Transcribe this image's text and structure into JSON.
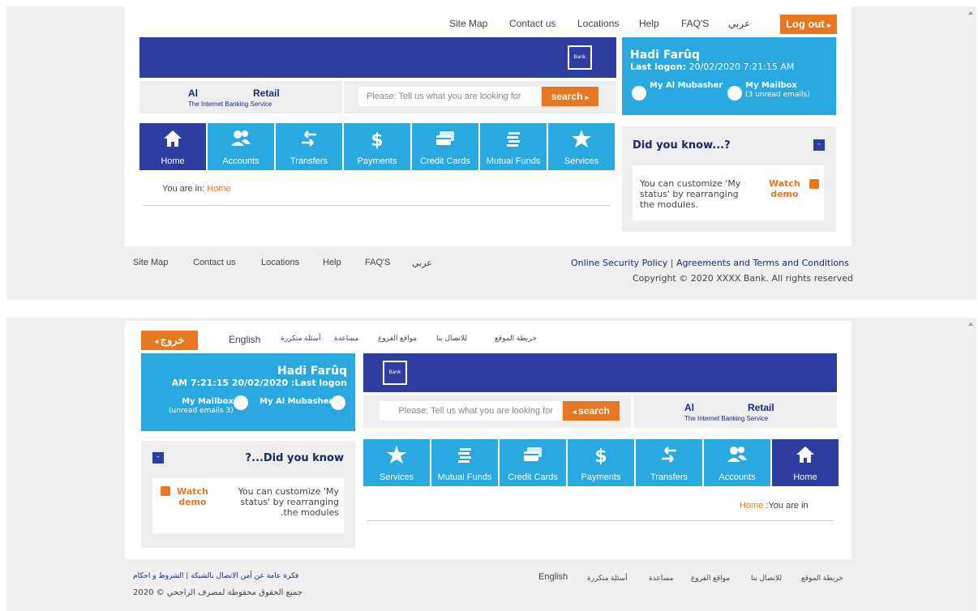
{
  "top_nav_en": [
    "Site Map",
    "Contact us",
    "Locations",
    "Help",
    "FAQ'S",
    "عربي"
  ],
  "top_nav_ar": [
    "خريطة الموقع",
    "للاتصال بنا",
    "مواقع الفروع",
    "مساعدة",
    "أسئلة متكررة",
    "English"
  ],
  "logout_en": "Log out",
  "logout_ar": "خروج",
  "bank_logo_text": "Bank",
  "brand": {
    "al": "Al",
    "retail": "Retail",
    "sub": "The Internet Banking Service"
  },
  "search": {
    "placeholder": "Please: Tell us what you are looking for",
    "button": "search"
  },
  "user": {
    "name": "Hadi Farûq",
    "last_logon_label_en": "Last logon:",
    "last_logon_value_en": "20/02/2020 7:21:15 AM",
    "last_logon_ar": "AM 7:21:15 20/02/2020 :Last logon",
    "mubasher": "My Al Mubasher",
    "mailbox": "My Mailbox",
    "unread_en": "(3 unread emails)",
    "unread_ar": "(unread emails 3)"
  },
  "nav_en": [
    "Home",
    "Accounts",
    "Transfers",
    "Payments",
    "Credit Cards",
    "Mutual Funds",
    "Services"
  ],
  "nav_ar": [
    "Services",
    "Mutual Funds",
    "Credit Cards",
    "Payments",
    "Transfers",
    "Accounts",
    "Home"
  ],
  "breadcrumb": {
    "label_en": "You are in:",
    "home": "Home",
    "label_ar": ":You are in"
  },
  "did_you_know": {
    "title_en": "Did you know...?",
    "title_ar": "?...Did you know",
    "toggle": "-",
    "text_en_1": "You can customize 'My",
    "text_en_2": "status' by rearranging",
    "text_en_3": "the modules.",
    "text_ar_1": "You can customize 'My",
    "text_ar_2": "status' by rearranging",
    "text_ar_3": ".the modules",
    "watch_1": "Watch",
    "watch_2": "demo"
  },
  "footer_en": {
    "links": [
      "Site Map",
      "Contact us",
      "Locations",
      "Help",
      "FAQ'S",
      "عربي"
    ],
    "security": "Online Security Policy",
    "separator": "|",
    "terms": "Agreements and Terms and Conditions",
    "copyright": "Copyright © 2020 XXXX Bank. All rights reserved"
  },
  "footer_ar": {
    "links": [
      "خريطة الموقع",
      "للاتصال بنا",
      "مواقع الفروع",
      "مساعدة",
      "أسئلة متكررة",
      "English"
    ],
    "security": "فكرة عامة عن أمن الاتصال بالشبكة",
    "separator": "|",
    "terms": "الشروط و احكام",
    "copyright": "جميع الحقوق محفوظة لمصرف الراجحي © 2020"
  },
  "colors": {
    "navy": "#2e3ea0",
    "sky": "#29a9e0",
    "orange": "#e87722"
  }
}
